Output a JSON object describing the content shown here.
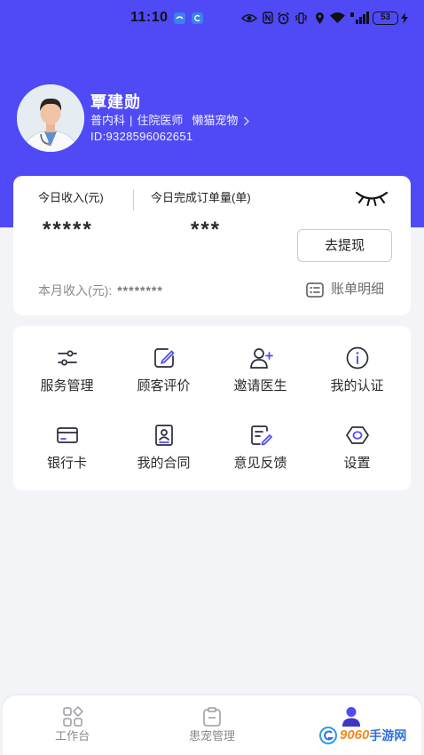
{
  "status_bar": {
    "time": "11:10",
    "battery": "53",
    "icons": [
      "notification-app-icon",
      "eye-icon",
      "nfc-icon",
      "alarm-icon",
      "vibrate-icon",
      "location-icon",
      "wifi-icon",
      "signal-icon",
      "battery-icon",
      "charging-icon"
    ]
  },
  "profile": {
    "name": "覃建勋",
    "department": "普内科",
    "separator": "|",
    "position": "住院医师",
    "hospital": "懒猫宠物",
    "id": "ID:9328596062651"
  },
  "income_card": {
    "today_income_label": "今日收入(元)",
    "today_orders_label": "今日完成订单量(单)",
    "today_income_value": "*****",
    "today_orders_value": "***",
    "visibility_icon": "eye-closed-icon",
    "withdraw_button": "去提现",
    "month_income_label": "本月收入(元):",
    "month_income_value": "********",
    "bill_detail_label": "账单明细",
    "bill_detail_icon": "list-icon"
  },
  "menu": [
    {
      "label": "服务管理",
      "icon": "sliders-icon"
    },
    {
      "label": "顾客评价",
      "icon": "edit-icon"
    },
    {
      "label": "邀请医生",
      "icon": "invite-user-icon"
    },
    {
      "label": "我的认证",
      "icon": "info-icon"
    },
    {
      "label": "银行卡",
      "icon": "bank-card-icon"
    },
    {
      "label": "我的合同",
      "icon": "contract-icon"
    },
    {
      "label": "意见反馈",
      "icon": "feedback-icon"
    },
    {
      "label": "设置",
      "icon": "settings-icon"
    }
  ],
  "tab_bar": {
    "tabs": [
      {
        "label": "工作台",
        "icon": "grid-icon",
        "active": false
      },
      {
        "label": "患宠管理",
        "icon": "clipboard-icon",
        "active": false
      },
      {
        "icon": "person-icon",
        "active": true
      }
    ]
  },
  "watermark": {
    "number": "9060",
    "text": "手游网"
  },
  "colors": {
    "primary": "#4f4af5",
    "page_background": "#f3f4f8",
    "card_background": "#ffffff",
    "watermark_orange": "#f08a1c",
    "watermark_blue": "#2f6fd8"
  }
}
